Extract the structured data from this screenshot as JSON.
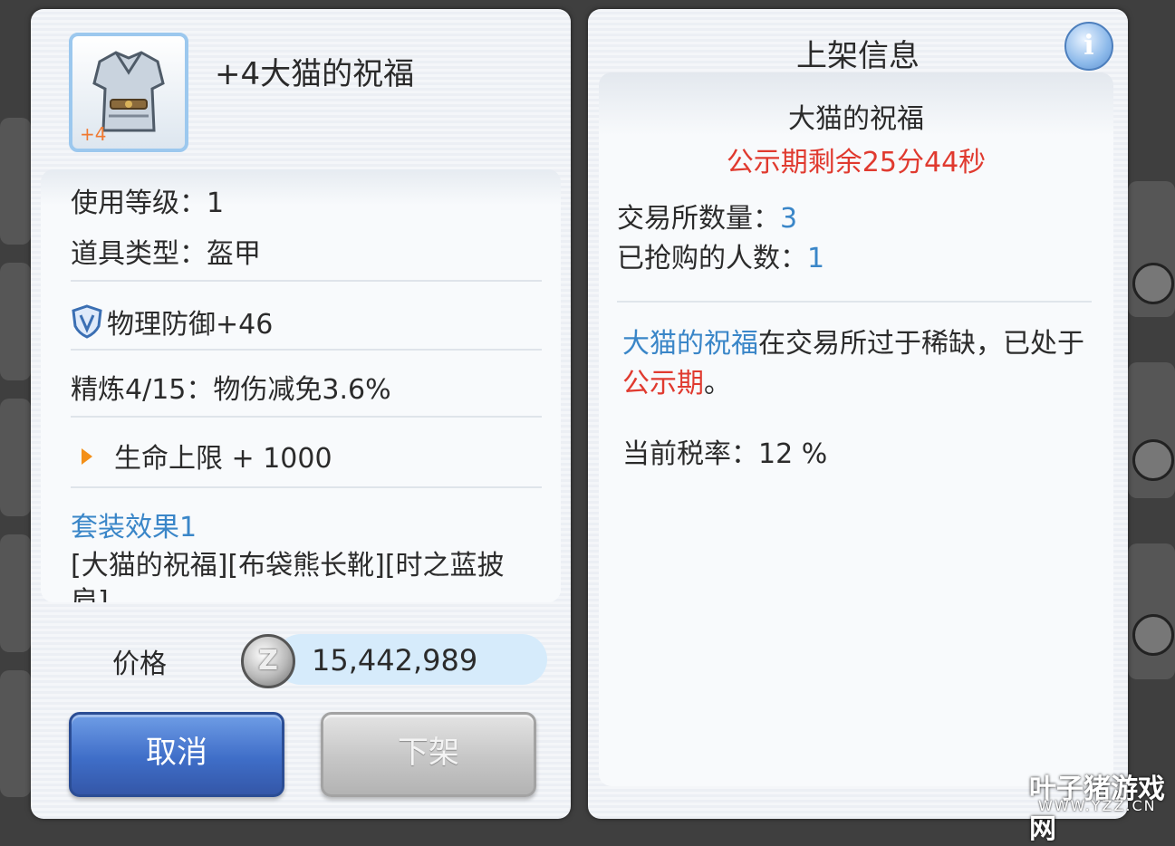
{
  "left_panel": {
    "item_name": "+4大猫的祝福",
    "refine_badge": "+4",
    "stats": {
      "use_level": "使用等级：1",
      "item_type": "道具类型：盔甲",
      "physical_defense": "物理防御+46",
      "refine": "精炼4/15：物伤减免3.6%",
      "hp_bonus": "生命上限 + 1000",
      "set_title": "套装效果1",
      "set_items": "[大猫的祝福][布袋熊长靴][时之蓝披肩]"
    },
    "price_label": "价格",
    "price_value": "15,442,989",
    "zeny_symbol": "Z",
    "buttons": {
      "cancel": "取消",
      "delist": "下架"
    }
  },
  "right_panel": {
    "title": "上架信息",
    "info_icon": "i",
    "item_name": "大猫的祝福",
    "countdown": "公示期剩余25分44秒",
    "exchange_count_label": "交易所数量：",
    "exchange_count": "3",
    "buyers_label": "已抢购的人数：",
    "buyers_count": "1",
    "notice": {
      "item": "大猫的祝福",
      "text1": "在交易所过于稀缺，已处于",
      "period": "公示期",
      "text2": "。"
    },
    "tax_rate": "当前税率：12 %"
  },
  "watermark": {
    "brand": "叶子猪游戏网",
    "url": "WWW.YZZ.CN"
  },
  "colors": {
    "accent_blue": "#3a86c8",
    "alert_red": "#e03a2f",
    "cancel_button": "#3f6ec8",
    "delist_button": "#c6c6c6"
  }
}
